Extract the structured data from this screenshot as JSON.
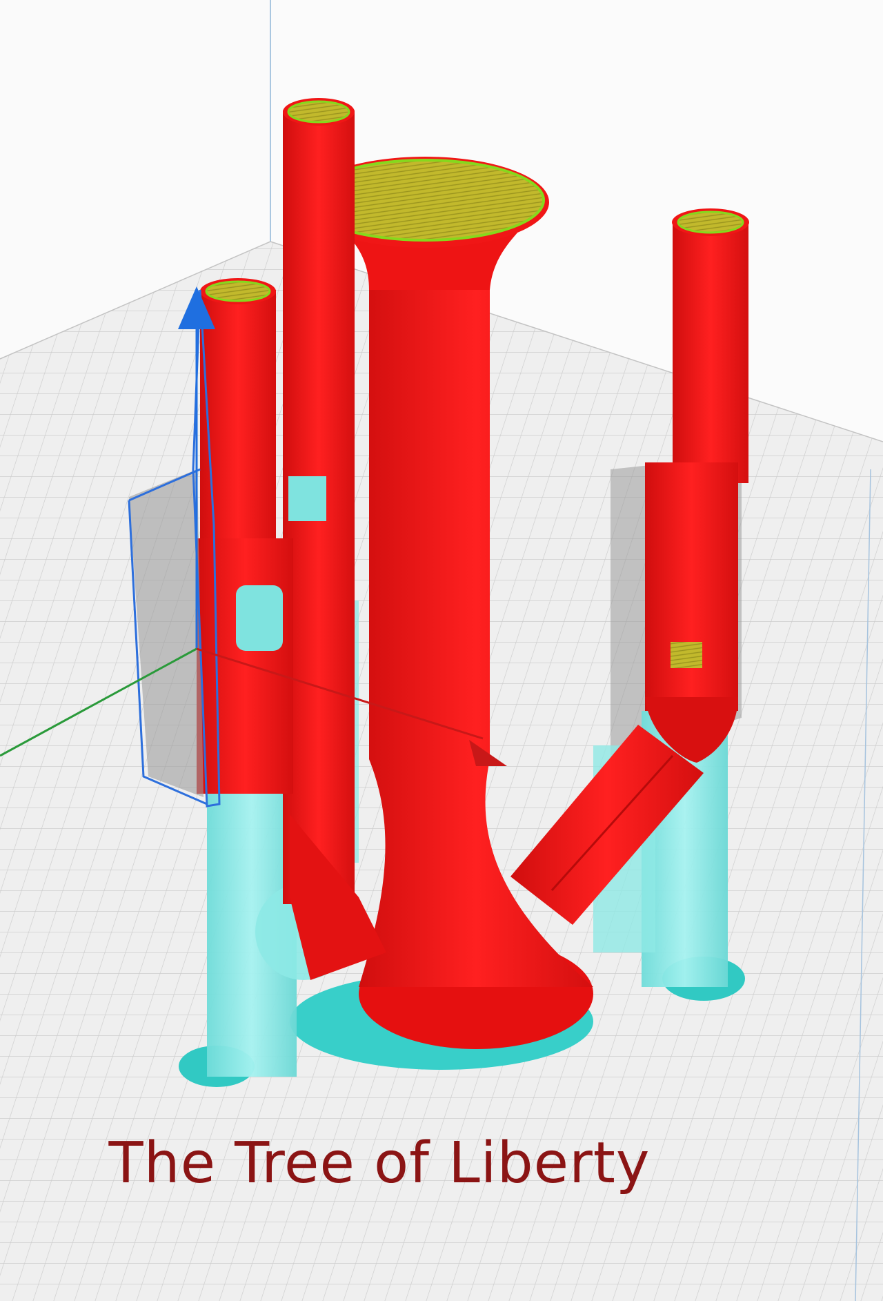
{
  "caption": "The Tree of Liberty",
  "colors": {
    "model": "#f01616",
    "support": "#7fe9e6",
    "support_dark": "#2fc9c4",
    "infill": "#b9b22a",
    "infill_line": "#7bd11d",
    "gizmo_y": "#1f6fe0",
    "gizmo_x": "#d32020",
    "gizmo_z": "#2a9a3a",
    "bed": "#ededed",
    "grid": "#c9c9c9"
  },
  "icons": [
    "move-gizmo-y-arrow-icon",
    "move-gizmo-x-arrow-icon"
  ]
}
